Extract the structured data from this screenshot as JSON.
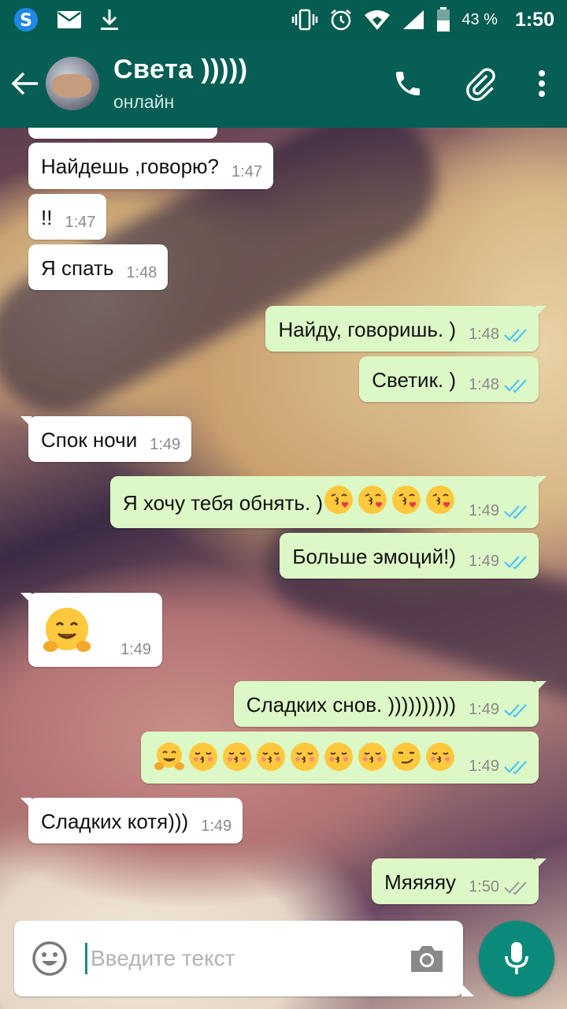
{
  "status_bar": {
    "battery_percent": "43 %",
    "time": "1:50"
  },
  "header": {
    "contact_name": "Света )))))",
    "contact_status": "онлайн"
  },
  "messages": [
    {
      "dir": "in",
      "text": "Найдешь ,говорю?",
      "time": "1:47"
    },
    {
      "dir": "in",
      "text": "!!",
      "time": "1:47"
    },
    {
      "dir": "in",
      "text": "Я спать",
      "time": "1:48"
    },
    {
      "dir": "out",
      "text": "Найду, говоришь. )",
      "time": "1:48",
      "status": "read"
    },
    {
      "dir": "out",
      "text": "Светик. )",
      "time": "1:48",
      "status": "read"
    },
    {
      "dir": "in",
      "text": "Спок ночи",
      "time": "1:49"
    },
    {
      "dir": "out",
      "text": "Я хочу тебя обнять. )",
      "emojis": [
        "kiss-heart",
        "kiss-heart",
        "kiss-heart",
        "kiss-heart"
      ],
      "time": "1:49",
      "status": "read"
    },
    {
      "dir": "out",
      "text": "Больше эмоций!)",
      "time": "1:49",
      "status": "read"
    },
    {
      "dir": "in",
      "emojis": [
        "hugging"
      ],
      "time": "1:49"
    },
    {
      "dir": "out",
      "text": "Сладких снов. ))))))))))",
      "time": "1:49",
      "status": "read"
    },
    {
      "dir": "out",
      "emojis": [
        "hugging",
        "kiss-closed-eyes",
        "kiss-closed-eyes",
        "kiss-closed-eyes",
        "kiss-closed-eyes",
        "kiss-closed-eyes",
        "kiss-closed-eyes",
        "smirk",
        "kiss-closed-eyes"
      ],
      "time": "1:49",
      "status": "read"
    },
    {
      "dir": "in",
      "text": "Сладких котя)))",
      "time": "1:49"
    },
    {
      "dir": "out",
      "text": "Мяяяяу",
      "time": "1:50",
      "status": "delivered"
    }
  ],
  "composer": {
    "placeholder": "Введите текст"
  },
  "colors": {
    "header": "#075e54",
    "status_bar": "#055c50",
    "outgoing_bubble": "#dcf8c6",
    "incoming_bubble": "#ffffff",
    "read_ticks": "#4fc3f7",
    "delivered_ticks": "#9e9e9e",
    "mic_button": "#0b8a7b"
  }
}
